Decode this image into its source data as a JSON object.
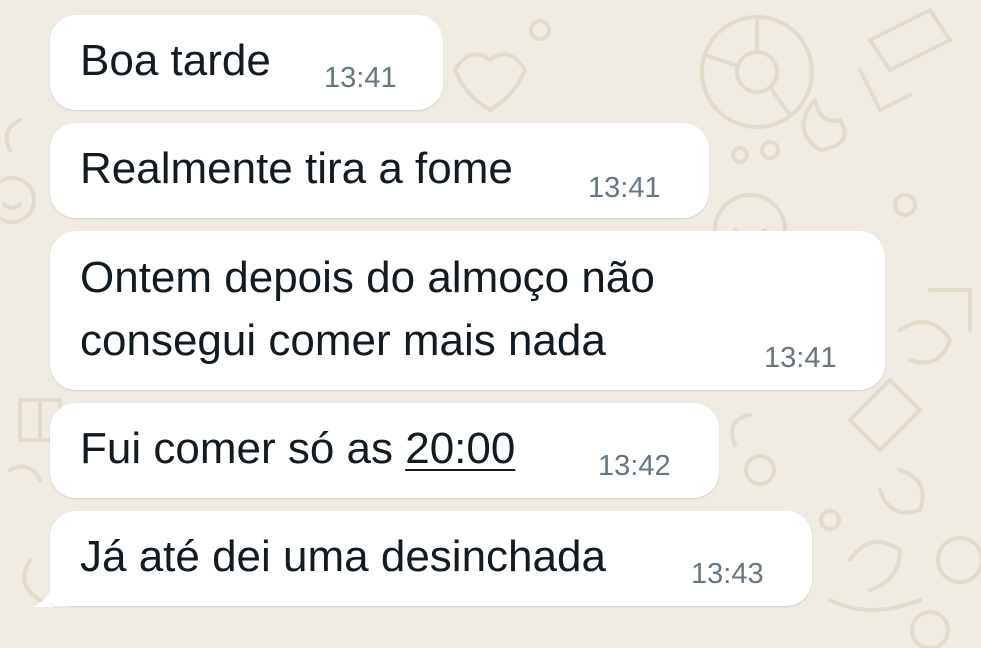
{
  "chat": {
    "colors": {
      "background": "#efeae2",
      "bubble": "#ffffff",
      "text": "#111b21",
      "timestamp": "#667781"
    },
    "messages": [
      {
        "lines": [
          "Boa tarde"
        ],
        "time": "13:41"
      },
      {
        "lines": [
          "Realmente tira a fome"
        ],
        "time": "13:41"
      },
      {
        "lines": [
          "Ontem depois do almoço não",
          "consegui comer mais nada"
        ],
        "time": "13:41"
      },
      {
        "prefix": "Fui comer só as ",
        "link": "20:00",
        "time": "13:42"
      },
      {
        "lines": [
          "Já até dei uma desinchada"
        ],
        "time": "13:43"
      }
    ]
  }
}
